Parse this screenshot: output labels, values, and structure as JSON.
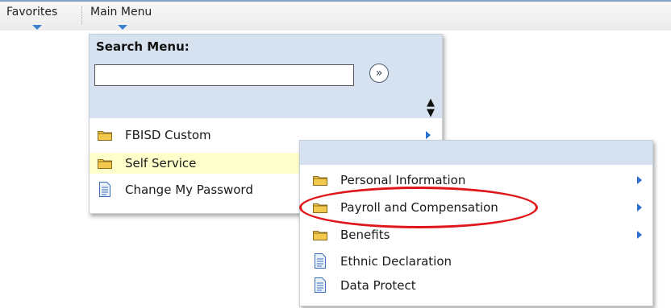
{
  "topnav": {
    "favorites_label": "Favorites",
    "main_menu_label": "Main Menu"
  },
  "main_menu": {
    "search_label": "Search Menu:",
    "search_value": "",
    "go_button": "»",
    "sort_icon": "sort-updown-icon",
    "items": [
      {
        "label": "FBISD Custom",
        "icon": "folder-icon",
        "has_submenu": true,
        "highlighted": false
      },
      {
        "label": "Self Service",
        "icon": "folder-icon",
        "has_submenu": false,
        "highlighted": true
      },
      {
        "label": "Change My Password",
        "icon": "document-icon",
        "has_submenu": false,
        "highlighted": false
      }
    ]
  },
  "submenu": {
    "items": [
      {
        "label": "Personal Information",
        "icon": "folder-icon",
        "has_submenu": true
      },
      {
        "label": "Payroll and Compensation",
        "icon": "folder-icon",
        "has_submenu": true,
        "circled": true
      },
      {
        "label": "Benefits",
        "icon": "folder-icon",
        "has_submenu": true
      },
      {
        "label": "Ethnic Declaration",
        "icon": "document-icon",
        "has_submenu": false
      },
      {
        "label": "Data Protect",
        "icon": "document-icon",
        "has_submenu": false
      }
    ]
  },
  "colors": {
    "panel_header": "#d6e2ef",
    "highlight": "#ffffcc",
    "folder": "#f2c94c",
    "arrow": "#2a6fd0",
    "annotation": "#e0161a"
  }
}
